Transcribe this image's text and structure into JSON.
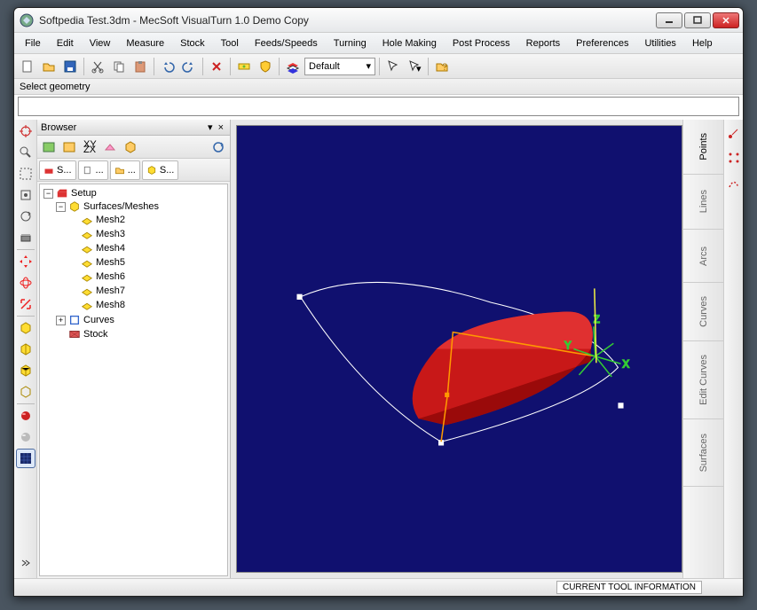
{
  "window": {
    "title": "Softpedia Test.3dm - MecSoft  VisualTurn 1.0 Demo Copy"
  },
  "menu": [
    "File",
    "Edit",
    "View",
    "Measure",
    "Stock",
    "Tool",
    "Feeds/Speeds",
    "Turning",
    "Hole Making",
    "Post Process",
    "Reports",
    "Preferences",
    "Utilities",
    "Help"
  ],
  "toolbar": {
    "layerCombo": "Default"
  },
  "command": {
    "prompt": "Select geometry",
    "input": ""
  },
  "browser": {
    "title": "Browser",
    "tabs": [
      "S...",
      "...",
      "...",
      "S..."
    ],
    "tree": {
      "root": "Setup",
      "group": "Surfaces/Meshes",
      "meshes": [
        "Mesh2",
        "Mesh3",
        "Mesh4",
        "Mesh5",
        "Mesh6",
        "Mesh7",
        "Mesh8"
      ],
      "curves": "Curves",
      "stock": "Stock"
    }
  },
  "viewport": {
    "axis": {
      "x": "X",
      "y": "Y",
      "z": "Z"
    }
  },
  "rightTabs": [
    "Points",
    "Lines",
    "Arcs",
    "Curves",
    "Edit Curves",
    "Surfaces"
  ],
  "status": {
    "toolInfo": "CURRENT TOOL INFORMATION"
  }
}
